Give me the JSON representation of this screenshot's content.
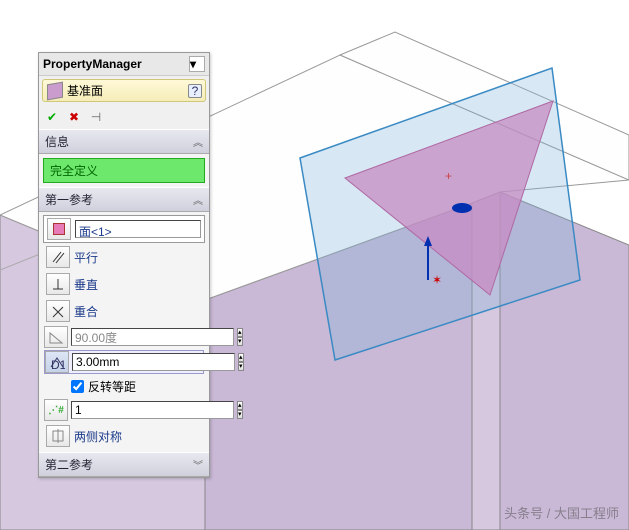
{
  "panel": {
    "title": "PropertyManager",
    "feature_name": "基准面",
    "help_char": "?"
  },
  "info": {
    "header": "信息",
    "status": "完全定义"
  },
  "ref1": {
    "header": "第一参考",
    "face_sel": "面<1>",
    "parallel": "平行",
    "perpendicular": "垂直",
    "coincident": "重合",
    "angle": "90.00度",
    "offset": "3.00mm",
    "reverse": "反转等距",
    "instances": "1",
    "midplane": "两侧对称"
  },
  "ref2": {
    "header": "第二参考"
  },
  "watermark": "头条号 / 大国工程师",
  "colors": {
    "accent_green": "#6de86d",
    "face_pink": "#e77bb8",
    "plane_blue": "#7db4d9",
    "solid_lav": "#d6c8df"
  }
}
